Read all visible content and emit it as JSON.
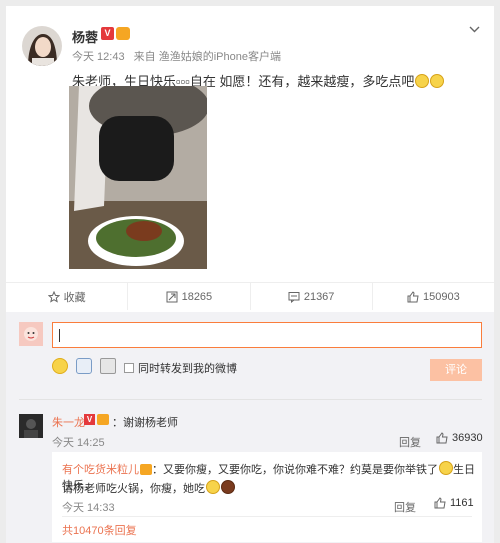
{
  "post": {
    "username": "杨蓉",
    "badge_text": "V",
    "time": "今天 12:43",
    "source_prefix": "来自",
    "source": "渔渔姑娘的iPhone客户端",
    "text": "朱老师，生日快乐▫▫▫自在 如愿！还有，越来越瘦，多吃点吧"
  },
  "actions": {
    "favorite": "收藏",
    "repost_count": "18265",
    "comment_count": "21367",
    "like_count": "150903"
  },
  "composer": {
    "repost_label": "同时转发到我的微博",
    "submit_label": "评论"
  },
  "comment": {
    "author": "朱一龙",
    "badge_text": "V",
    "text": "：谢谢杨老师",
    "time": "今天 14:25",
    "reply_label": "回复",
    "like_count": "36930"
  },
  "sub_comment": {
    "author": "有个吃货米粒儿",
    "text1": "：又要你瘦，又要你吃，你说你难不难？约莫是要你举铁了",
    "text1_tail": "生日快乐，",
    "text2": "请杨老师吃火锅，你瘦，她吃",
    "time": "今天 14:33",
    "reply_label": "回复",
    "like_count": "1161"
  },
  "total_replies": "共10470条回复",
  "colors": {
    "accent": "#fa7d3c",
    "name_color": "#eb7350",
    "vip_red": "#e4393c"
  }
}
